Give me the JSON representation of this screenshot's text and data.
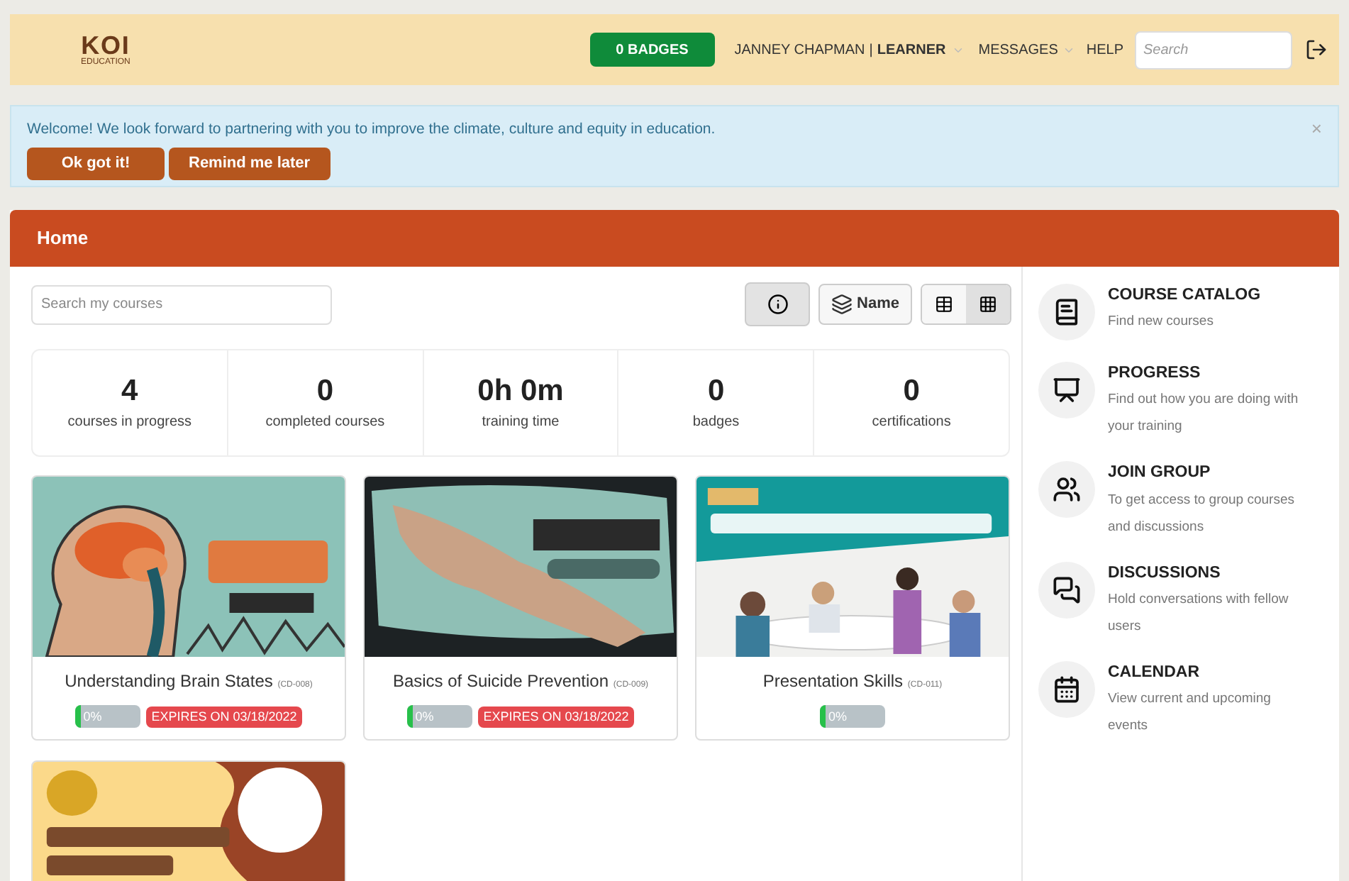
{
  "header": {
    "logo": "KOI",
    "logo_sub": "EDUCATION",
    "badges_button": "0 BADGES",
    "user": "JANNEY CHAPMAN",
    "separator": "|",
    "role": "LEARNER",
    "messages": "MESSAGES",
    "help": "HELP",
    "search": {
      "placeholder": "Search"
    }
  },
  "alert": {
    "message": "Welcome! We look forward to partnering with you to improve the climate, culture and equity in education.",
    "close": "×",
    "buttons": [
      "Ok got it!",
      "Remind me later"
    ]
  },
  "page_title": "Home",
  "course_search": {
    "placeholder": "Search my courses"
  },
  "sort_button": "Name",
  "views": [
    {
      "kind": "list",
      "selected": false
    },
    {
      "kind": "grid",
      "selected": true
    }
  ],
  "info_selected": true,
  "stats": [
    {
      "value": "4",
      "label": "courses in progress"
    },
    {
      "value": "0",
      "label": "completed courses"
    },
    {
      "value": "0h 0m",
      "label": "training time"
    },
    {
      "value": "0",
      "label": "badges"
    },
    {
      "value": "0",
      "label": "certifications"
    }
  ],
  "courses": [
    {
      "kind": "picture",
      "title": "Understanding Brain States",
      "code": "(CD-008)",
      "progress": "0%",
      "level": 0,
      "expires": "EXPIRES ON 03/18/2022"
    },
    {
      "kind": "picture",
      "title": "Basics of Suicide Prevention",
      "code": "(CD-009)",
      "progress": "0%",
      "level": 0,
      "expires": "EXPIRES ON 03/18/2022"
    },
    {
      "kind": "picture",
      "title": "Presentation Skills",
      "code": "(CD-011)",
      "progress": "0%",
      "level": 0
    },
    {
      "kind": "picture"
    }
  ],
  "sidebar": {
    "items": [
      {
        "kind": "book",
        "title": "COURSE CATALOG",
        "text": "Find new courses"
      },
      {
        "kind": "progress",
        "title": "PROGRESS",
        "text": "Find out how you are doing with your training"
      },
      {
        "kind": "group",
        "title": "JOIN GROUP",
        "text": "To get access to group courses and discussions"
      },
      {
        "kind": "chat",
        "title": "DISCUSSIONS",
        "text": "Hold conversations with fellow users"
      },
      {
        "kind": "calendar",
        "title": "CALENDAR",
        "text": "View current and upcoming events"
      }
    ]
  }
}
